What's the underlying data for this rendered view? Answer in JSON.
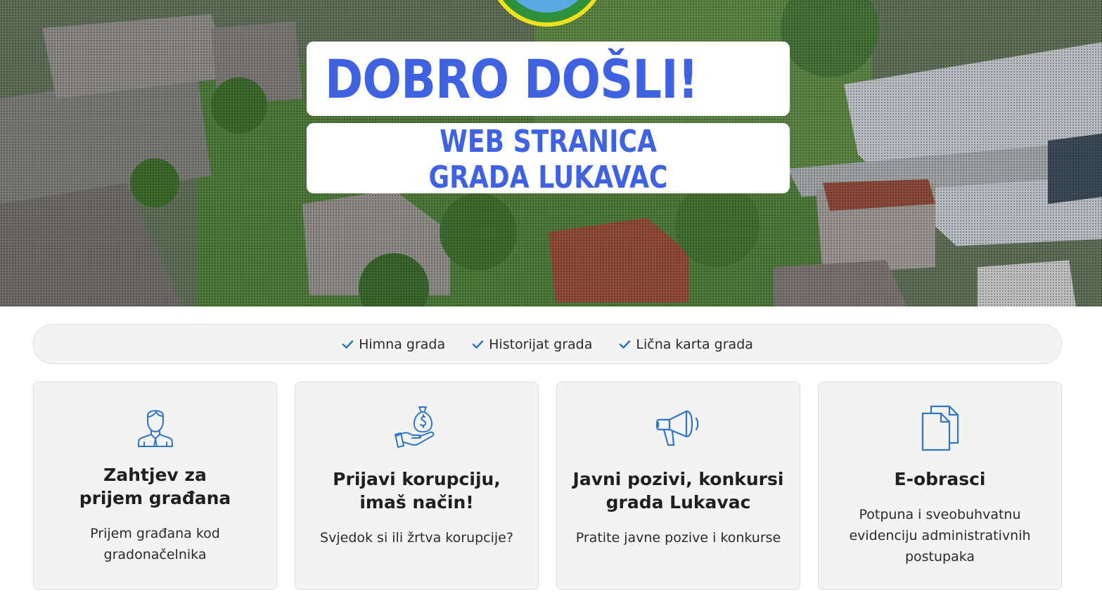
{
  "hero": {
    "welcome": "DOBRO DOŠLI!",
    "subtitle_line1": "WEB STRANICA",
    "subtitle_line2": "GRADA LUKAVAC",
    "accent_color": "#3f62e0"
  },
  "quick_links": [
    {
      "label": "Himna grada",
      "icon": "check-icon"
    },
    {
      "label": "Historijat grada",
      "icon": "check-icon"
    },
    {
      "label": "Lična karta grada",
      "icon": "check-icon"
    }
  ],
  "cards": [
    {
      "title_line1": "Zahtjev za",
      "title_line2": "prijem građana",
      "desc_line1": "Prijem građana kod",
      "desc_line2": "gradonačelnika",
      "icon": "person-icon"
    },
    {
      "title_line1": "Prijavi korupciju,",
      "title_line2": "imaš način!",
      "desc_line1": "Svjedok si ili žrtva korupcije?",
      "icon": "money-bag-hand-icon"
    },
    {
      "title_line1": "Javni pozivi, konkursi",
      "title_line2": "grada Lukavac",
      "desc_line1": "Pratite javne pozive i konkurse",
      "icon": "megaphone-icon"
    },
    {
      "title_line1": "E-obrasci",
      "desc_line1": "Potpuna i sveobuhvatnu",
      "desc_line2": "evidenciju administrativnih",
      "desc_line3": "postupaka",
      "icon": "documents-icon"
    }
  ],
  "colors": {
    "icon_blue": "#2f76c8",
    "check_blue": "#2f76c8"
  }
}
